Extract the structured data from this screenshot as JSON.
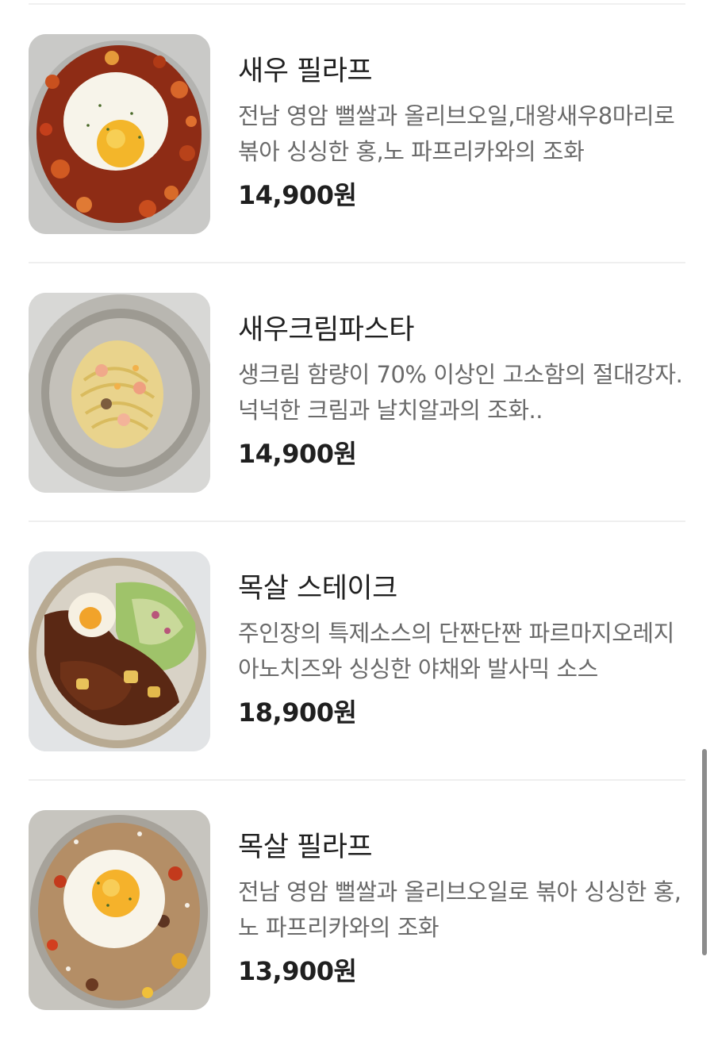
{
  "menu": {
    "items": [
      {
        "name": "새우 필라프",
        "description": "전남 영암 뻘쌀과 올리브오일,대왕새우8마리로 볶아 싱싱한 홍,노 파프리카와의 조화",
        "price": "14,900원",
        "image": "shrimp-pilaf-photo"
      },
      {
        "name": "새우크림파스타",
        "description": "생크림 함량이 70% 이상인 고소함의 절대강자. 넉넉한 크림과 날치알과의 조화..",
        "price": "14,900원",
        "image": "shrimp-cream-pasta-photo"
      },
      {
        "name": "목살 스테이크",
        "description": "주인장의 특제소스의 단짠단짠 파르마지오레지아노치즈와 싱싱한 야채와 발사믹 소스",
        "price": "18,900원",
        "image": "pork-neck-steak-photo"
      },
      {
        "name": "목살 필라프",
        "description": "전남 영암 뻘쌀과 올리브오일로 볶아 싱싱한 홍,노 파프리카와의 조화",
        "price": "13,900원",
        "image": "pork-neck-pilaf-photo"
      }
    ]
  },
  "colors": {
    "name": "#202020",
    "description": "#6a6a6a",
    "price": "#1f1f1f",
    "divider": "#efefef",
    "scrollbar": "#8c8c8c"
  }
}
